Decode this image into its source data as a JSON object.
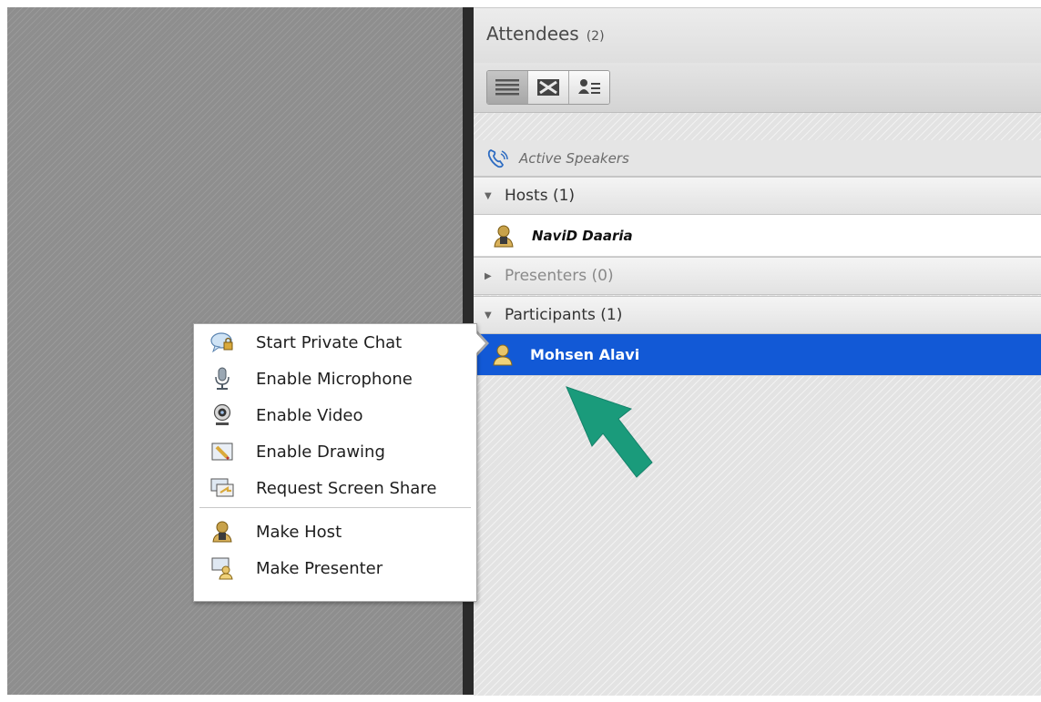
{
  "panel": {
    "title": "Attendees",
    "count": "(2)",
    "view_buttons": [
      "list-view-icon",
      "grid-view-icon",
      "attendee-status-view-icon"
    ],
    "active_speakers_label": "Active Speakers"
  },
  "groups": {
    "hosts": {
      "label": "Hosts (1)",
      "members": [
        "NaviD Daaria"
      ]
    },
    "presenters": {
      "label": "Presenters (0)"
    },
    "participants": {
      "label": "Participants (1)",
      "members": [
        "Mohsen  Alavi"
      ]
    }
  },
  "context_menu": {
    "items": [
      {
        "label": "Start Private Chat",
        "icon": "chat-bubble-icon"
      },
      {
        "label": "Enable Microphone",
        "icon": "microphone-icon"
      },
      {
        "label": "Enable Video",
        "icon": "webcam-icon"
      },
      {
        "label": "Enable Drawing",
        "icon": "pencil-drawing-icon"
      },
      {
        "label": "Request Screen Share",
        "icon": "screen-share-icon"
      },
      {
        "label": "Make Host",
        "icon": "host-user-icon"
      },
      {
        "label": "Make Presenter",
        "icon": "presenter-icon"
      }
    ]
  },
  "colors": {
    "selection": "#1259d6",
    "annotation_arrow": "#1a9b7b"
  }
}
